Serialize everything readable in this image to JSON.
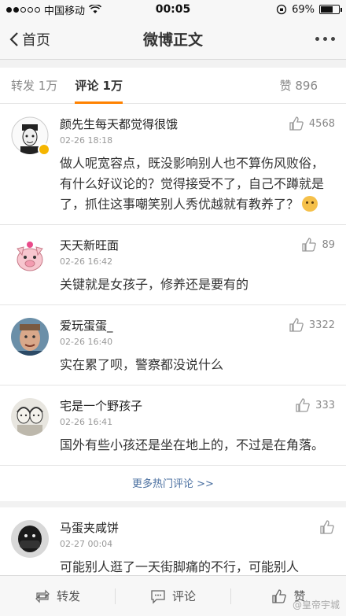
{
  "status": {
    "carrier": "中国移动",
    "time": "00:05",
    "battery": "69%",
    "battery_level": 0.69
  },
  "nav": {
    "back_label": "首页",
    "title": "微博正文"
  },
  "tabs": {
    "reposts": "转发 1万",
    "comments": "评论 1万",
    "likes": "赞 896"
  },
  "comments": [
    {
      "name": "颜先生每天都觉得很饿",
      "time": "02-26 18:18",
      "likes": "4568",
      "text": "做人呢宽容点，既没影响别人也不算伤风败俗，有什么好议论的？觉得接受不了，自己不蹲就是了，抓住这事嘲笑别人秀优越就有教养了？",
      "avatar": "man-sketch-avatar",
      "verified": true
    },
    {
      "name": "天天新旺面",
      "time": "02-26 16:42",
      "likes": "89",
      "text": "关键就是女孩子，修养还是要有的",
      "avatar": "pig-avatar"
    },
    {
      "name": "爱玩蛋蛋_",
      "time": "02-26 16:40",
      "likes": "3322",
      "text": "实在累了呗，警察都没说什么",
      "avatar": "face-photo-avatar"
    },
    {
      "name": "宅是一个野孩子",
      "time": "02-26 16:41",
      "likes": "333",
      "text": "国外有些小孩还是坐在地上的，不过是在角落。",
      "avatar": "couple-sketch-avatar"
    }
  ],
  "more_hot": "更多热门评论 >>",
  "latest_comment": {
    "name": "马蛋夹咸饼",
    "time": "02-27 00:04",
    "text": "可能别人逛了一天街脚痛的不行，可能别人",
    "avatar": "masked-avatar"
  },
  "toolbar": {
    "repost": "转发",
    "comment": "评论",
    "like": "赞"
  },
  "watermark": "@皇帝宇城"
}
